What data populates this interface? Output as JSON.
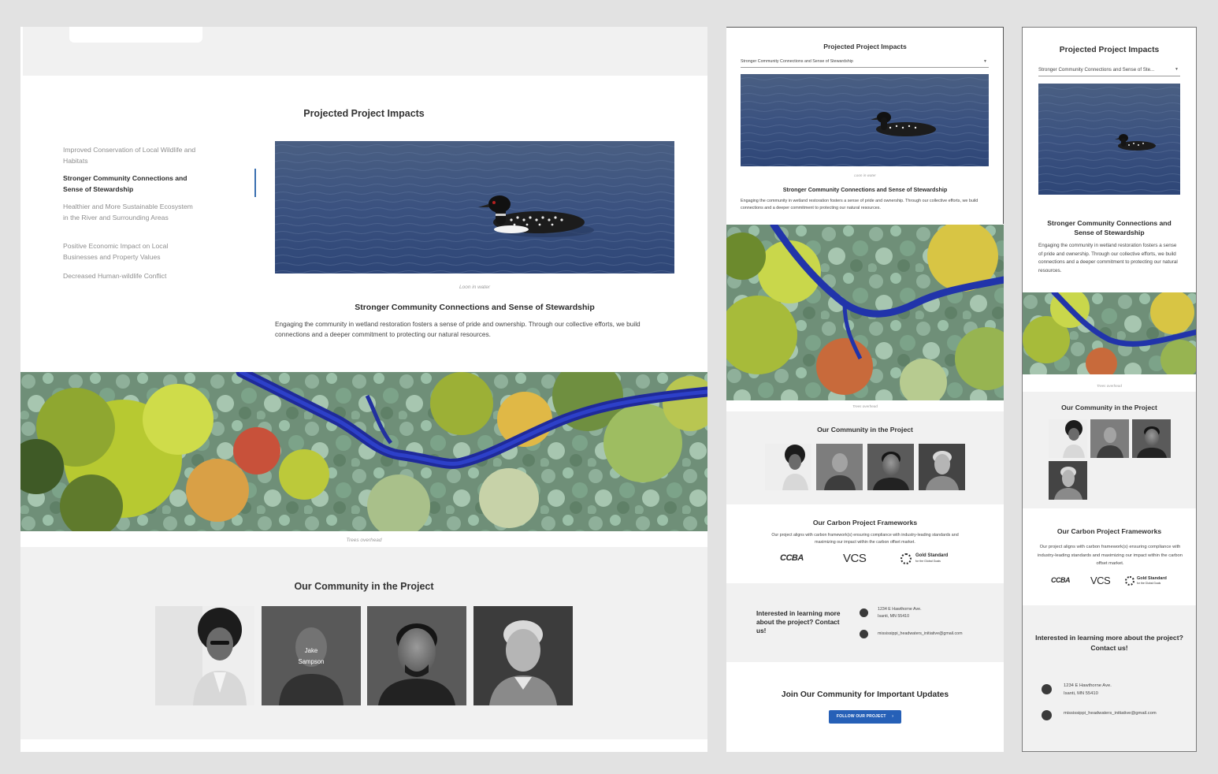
{
  "impacts": {
    "title": "Projected Project Impacts",
    "nav_items": [
      "Improved Conservation of Local Wildlife and Habitats",
      "Stronger Community Connections and Sense of Stewardship",
      "Healthier and More Sustainable Ecosystem in the River and Surrounding Areas",
      "Positive Economic Impact on Local Businesses and Property Values",
      "Decreased Human-wildlife Conflict"
    ],
    "selected": "Stronger Community Connections and Sense of Stewardship",
    "selected_short": "Stronger Community Connections and Sense of Ste...",
    "image_caption": "Loon in water",
    "heading": "Stronger Community Connections and Sense of Stewardship",
    "body": "Engaging the community in wetland restoration fosters a sense of pride and ownership. Through our collective efforts, we build connections and a deeper commitment to protecting our natural resources."
  },
  "landscape": {
    "caption": "Trees overhead"
  },
  "community": {
    "title": "Our Community in the Project",
    "hover_name_first": "Jake",
    "hover_name_last": "Sampson"
  },
  "frameworks": {
    "title": "Our Carbon Project Frameworks",
    "body": "Our project aligns with carbon framework(s) ensuring compliance with industry-leading standards and maximizing our impact within the carbon offset market.",
    "logos": {
      "ccba": "CCBA",
      "vcs": "VCS",
      "gold_line1": "Gold Standard",
      "gold_line2": "for the Global Goals"
    }
  },
  "contact": {
    "prompt": "Interested in learning more about the project? Contact us!",
    "address_line1": "1234 E Hawthorne Ave.",
    "address_line2": "Isanti, MN 55410",
    "email": "mississippi_headwaters_initiative@gmail.com"
  },
  "join": {
    "title": "Join Our Community for Important Updates",
    "button_label": "FOLLOW OUR PROJECT",
    "button_icon": "›"
  },
  "colors": {
    "accent": "#2660b7",
    "indicator": "#3a6fb0",
    "section_bg": "#f1f1f1",
    "canvas_bg": "#e2e2e2"
  }
}
